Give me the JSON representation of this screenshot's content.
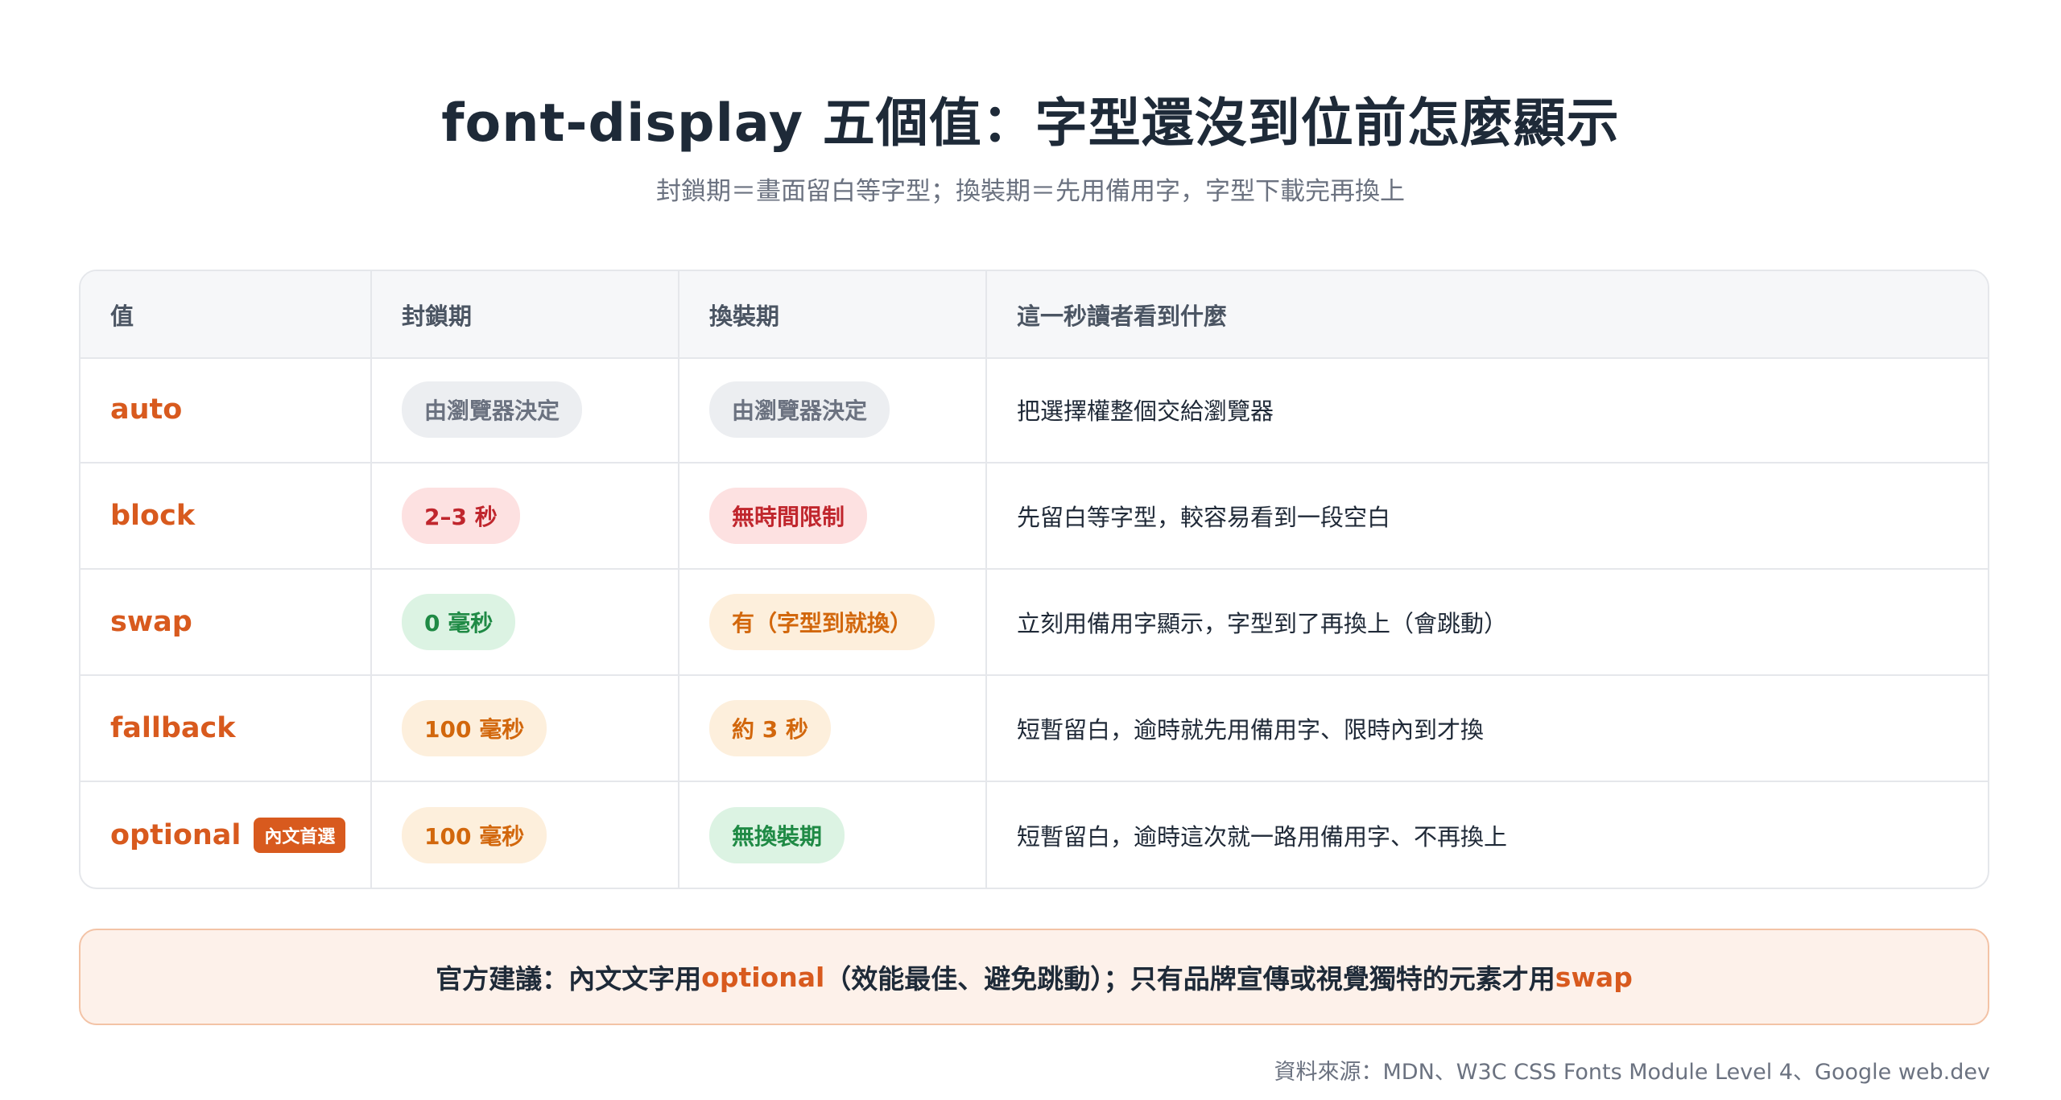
{
  "title": "font-display 五個值：字型還沒到位前怎麼顯示",
  "subtitle": "封鎖期＝畫面留白等字型；換裝期＝先用備用字，字型下載完再換上",
  "table": {
    "headers": [
      "值",
      "封鎖期",
      "換裝期",
      "這一秒讀者看到什麼"
    ],
    "rows": [
      {
        "value": "auto",
        "tag": "",
        "block": "由瀏覽器決定",
        "block_color": "gray",
        "swap": "由瀏覽器決定",
        "swap_color": "gray",
        "desc": "把選擇權整個交給瀏覽器"
      },
      {
        "value": "block",
        "tag": "",
        "block": "2–3 秒",
        "block_color": "red",
        "swap": "無時間限制",
        "swap_color": "red",
        "desc": "先留白等字型，較容易看到一段空白"
      },
      {
        "value": "swap",
        "tag": "",
        "block": "0 毫秒",
        "block_color": "green",
        "swap": "有（字型到就換）",
        "swap_color": "orange",
        "desc": "立刻用備用字顯示，字型到了再換上（會跳動）"
      },
      {
        "value": "fallback",
        "tag": "",
        "block": "100 毫秒",
        "block_color": "orange",
        "swap": "約 3 秒",
        "swap_color": "orange",
        "desc": "短暫留白，逾時就先用備用字、限時內到才換"
      },
      {
        "value": "optional",
        "tag": "內文首選",
        "block": "100 毫秒",
        "block_color": "orange",
        "swap": "無換裝期",
        "swap_color": "green",
        "desc": "短暫留白，逾時這次就一路用備用字、不再換上"
      }
    ]
  },
  "note": {
    "prefix": "官方建議：內文文字用 ",
    "hl1": "optional",
    "middle": "（效能最佳、避免跳動）；只有品牌宣傳或視覺獨特的元素才用 ",
    "hl2": "swap"
  },
  "source": "資料來源：MDN、W3C CSS Fonts Module Level 4、Google web.dev",
  "colors": {
    "accent": "#d85a1e",
    "gray_pill": "#eceef1",
    "red_pill": "#fde1e1",
    "green_pill": "#dcf3e3",
    "orange_pill": "#fdefdc"
  }
}
